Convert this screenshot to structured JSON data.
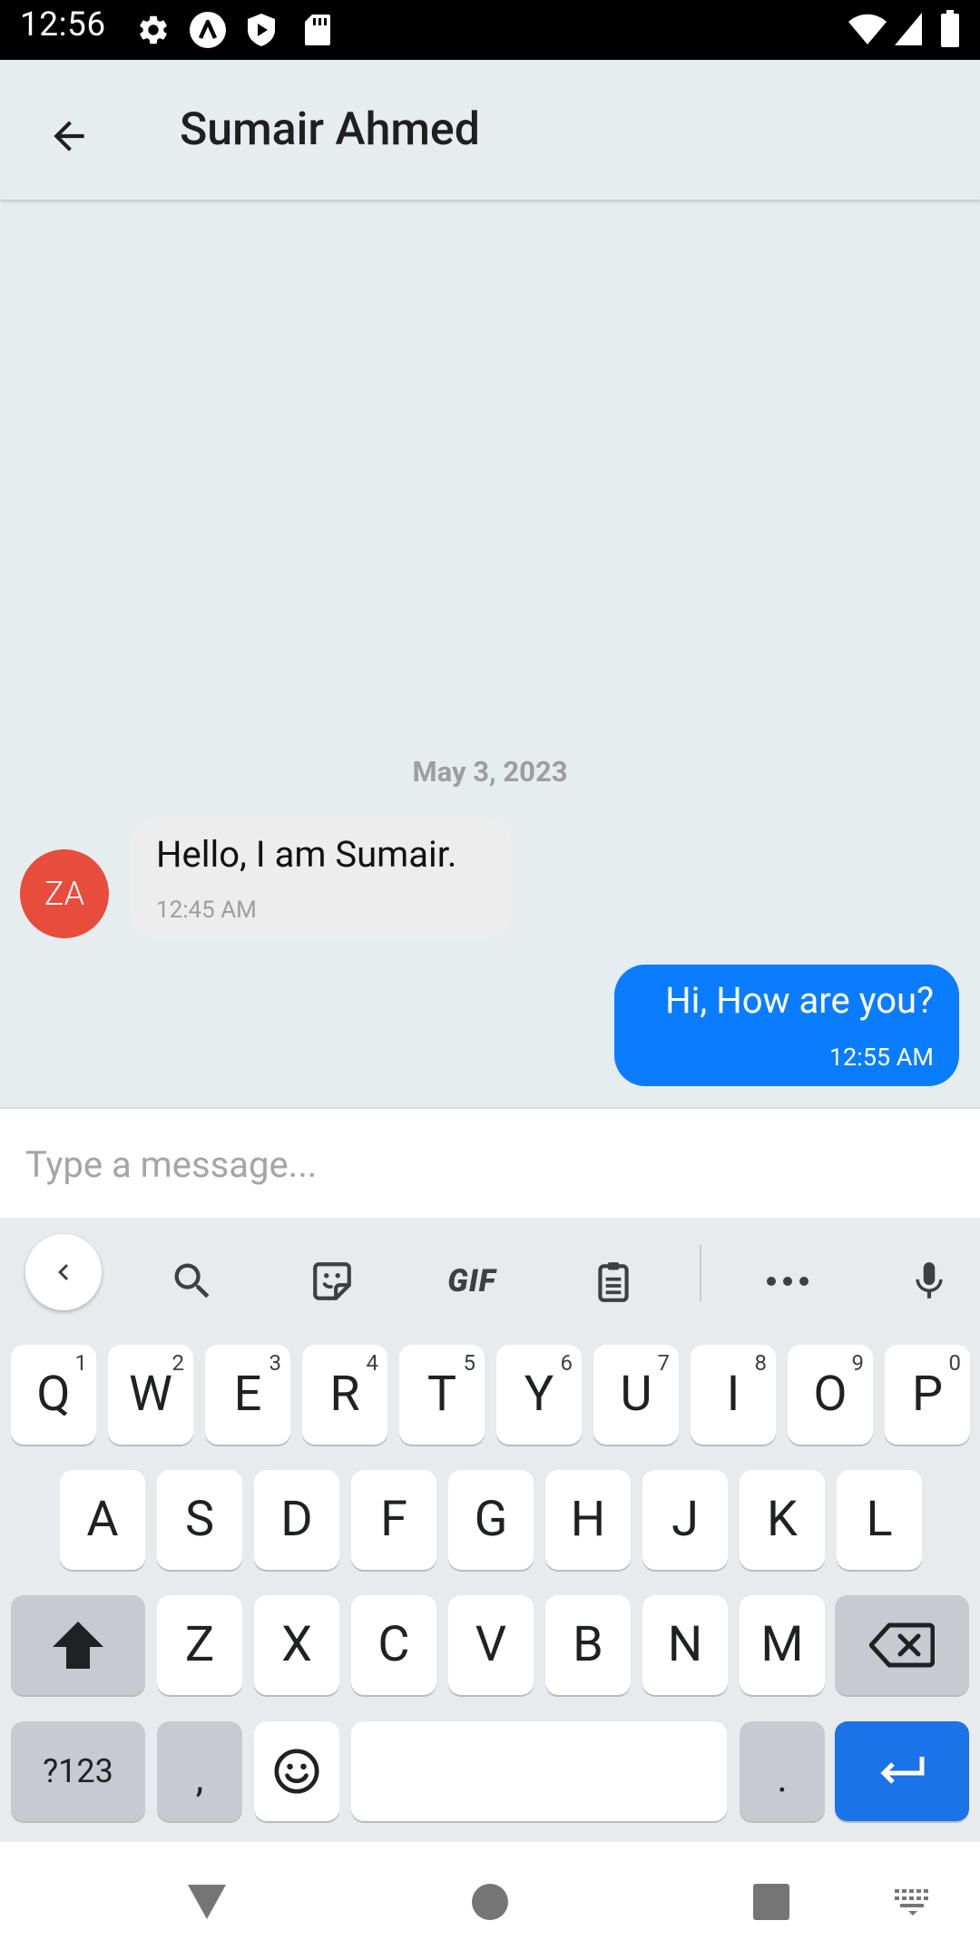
{
  "status_bar": {
    "time": "12:56",
    "left_icons": [
      "settings-icon",
      "arch-app-icon",
      "shield-play-icon",
      "sd-card-icon"
    ],
    "right_icons": [
      "wifi-icon",
      "signal-icon",
      "battery-icon"
    ]
  },
  "header": {
    "back_icon": "arrow-left-icon",
    "contact_name": "Sumair Ahmed"
  },
  "chat": {
    "date_divider": "May 3, 2023",
    "messages": [
      {
        "direction": "incoming",
        "avatar_initials": "ZA",
        "text": "Hello, I am Sumair.",
        "time": "12:45 AM"
      },
      {
        "direction": "outgoing",
        "text": "Hi, How are you?",
        "time": "12:55 AM"
      }
    ]
  },
  "composer": {
    "placeholder": "Type a message...",
    "value": ""
  },
  "keyboard": {
    "toolbar": [
      "chevron-left-icon",
      "search-icon",
      "sticker-icon",
      "gif-icon",
      "clipboard-icon",
      "more-icon",
      "microphone-icon"
    ],
    "gif_label": "GIF",
    "row1": [
      {
        "letter": "Q",
        "hint": "1"
      },
      {
        "letter": "W",
        "hint": "2"
      },
      {
        "letter": "E",
        "hint": "3"
      },
      {
        "letter": "R",
        "hint": "4"
      },
      {
        "letter": "T",
        "hint": "5"
      },
      {
        "letter": "Y",
        "hint": "6"
      },
      {
        "letter": "U",
        "hint": "7"
      },
      {
        "letter": "I",
        "hint": "8"
      },
      {
        "letter": "O",
        "hint": "9"
      },
      {
        "letter": "P",
        "hint": "0"
      }
    ],
    "row2": [
      "A",
      "S",
      "D",
      "F",
      "G",
      "H",
      "J",
      "K",
      "L"
    ],
    "row3": [
      "Z",
      "X",
      "C",
      "V",
      "B",
      "N",
      "M"
    ],
    "symbols_label": "?123",
    "comma_label": ",",
    "period_label": ".",
    "accent_color": "#1a73e8"
  },
  "nav_bar": {
    "icons": [
      "back-triangle-icon",
      "home-circle-icon",
      "recents-square-icon",
      "keyboard-switch-icon"
    ]
  },
  "colors": {
    "outgoing_bubble": "#0a7cff",
    "incoming_bubble": "#ededed",
    "avatar": "#e74c3c",
    "chat_background": "#e5edef"
  }
}
